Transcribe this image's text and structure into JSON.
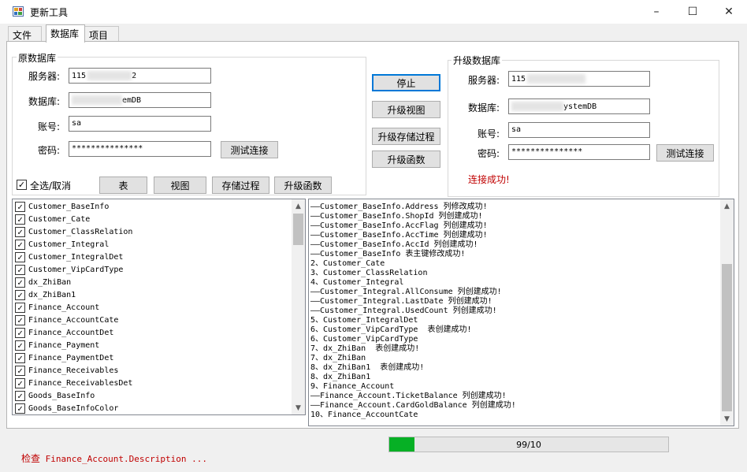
{
  "window": {
    "title": "更新工具",
    "minimize_glyph": "–",
    "maximize_glyph": "☐",
    "close_glyph": "✕"
  },
  "tabs": [
    "文件",
    "数据库",
    "项目"
  ],
  "source_db": {
    "group_label": "原数据库",
    "server_label": "服务器:",
    "server_value_prefix": "115",
    "server_value_suffix": "2",
    "database_label": "数据库:",
    "database_value_suffix": "emDB",
    "account_label": "账号:",
    "account_value": "sa",
    "password_label": "密码:",
    "password_value": "***************",
    "test_button": "测试连接"
  },
  "actions": {
    "stop": "停止",
    "upgrade_view": "升级视图",
    "upgrade_proc": "升级存储过程",
    "upgrade_func": "升级函数"
  },
  "target_db": {
    "group_label": "升级数据库",
    "server_label": "服务器:",
    "server_value_prefix": "115",
    "database_label": "数据库:",
    "database_value_suffix": "ystemDB",
    "account_label": "账号:",
    "account_value": "sa",
    "password_label": "密码:",
    "password_value": "***************",
    "test_button": "测试连接",
    "status": "连接成功!"
  },
  "filters": {
    "select_all": "全选/取消",
    "table": "表",
    "view": "视图",
    "proc": "存储过程",
    "func": "升级函数"
  },
  "tables": [
    "Customer_BaseInfo",
    "Customer_Cate",
    "Customer_ClassRelation",
    "Customer_Integral",
    "Customer_IntegralDet",
    "Customer_VipCardType",
    "dx_ZhiBan",
    "dx_ZhiBan1",
    "Finance_Account",
    "Finance_AccountCate",
    "Finance_AccountDet",
    "Finance_Payment",
    "Finance_PaymentDet",
    "Finance_Receivables",
    "Finance_ReceivablesDet",
    "Goods_BaseInfo",
    "Goods_BaseInfoColor"
  ],
  "log_lines": [
    "——Customer_BaseInfo.Address 列修改成功!",
    "——Customer_BaseInfo.ShopId 列创建成功!",
    "——Customer_BaseInfo.AccFlag 列创建成功!",
    "——Customer_BaseInfo.AccTime 列创建成功!",
    "——Customer_BaseInfo.AccId 列创建成功!",
    "——Customer_BaseInfo 表主键修改成功!",
    "2、Customer_Cate",
    "3、Customer_ClassRelation",
    "4、Customer_Integral",
    "——Customer_Integral.AllConsume 列创建成功!",
    "——Customer_Integral.LastDate 列创建成功!",
    "——Customer_Integral.UsedCount 列创建成功!",
    "5、Customer_IntegralDet",
    "6、Customer_VipCardType  表创建成功!",
    "6、Customer_VipCardType",
    "7、dx_ZhiBan  表创建成功!",
    "7、dx_ZhiBan",
    "8、dx_ZhiBan1  表创建成功!",
    "8、dx_ZhiBan1",
    "9、Finance_Account",
    "——Finance_Account.TicketBalance 列创建成功!",
    "——Finance_Account.CardGoldBalance 列创建成功!",
    "10、Finance_AccountCate"
  ],
  "progress": {
    "label": "99/10",
    "fraction": 0.09
  },
  "status_bar": {
    "prefix": "检查",
    "detail": "Finance_Account.Description ..."
  },
  "colors": {
    "success_text": "#c00000",
    "progress_fill": "#06b025",
    "accent_border": "#0078d7"
  },
  "icons": {
    "check": "✓",
    "scroll_up": "▲",
    "scroll_down": "▼"
  }
}
